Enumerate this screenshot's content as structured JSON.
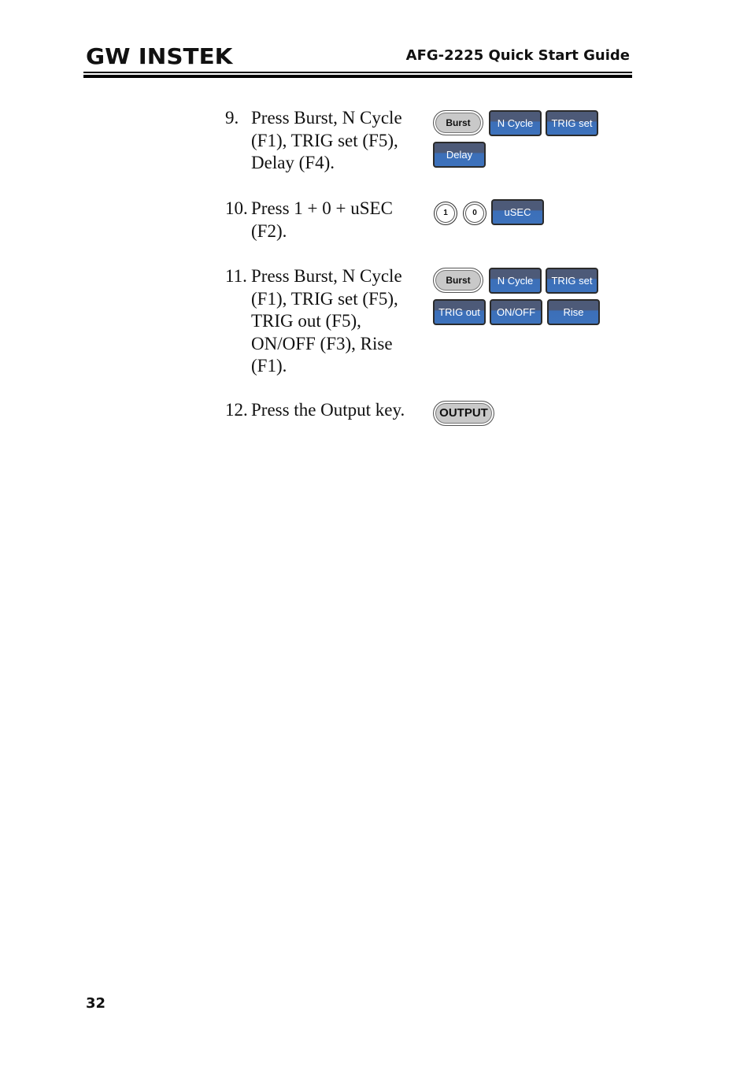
{
  "header": {
    "logo": "GW INSTEK",
    "title": "AFG-2225 Quick Start Guide"
  },
  "steps": [
    {
      "number": "9.",
      "lines": [
        "Press Burst, N Cycle",
        "(F1), TRIG set (F5),",
        "Delay (F4)."
      ],
      "keys": [
        {
          "label": "Burst",
          "type": "hard"
        },
        {
          "label": "N Cycle",
          "type": "soft"
        },
        {
          "label": "TRIG set",
          "type": "soft"
        },
        {
          "label": "Delay",
          "type": "soft"
        }
      ]
    },
    {
      "number": "10.",
      "lines": [
        "Press 1 + 0 + uSEC",
        "(F2)."
      ],
      "keys": [
        {
          "label": "1",
          "type": "number"
        },
        {
          "label": "0",
          "type": "number"
        },
        {
          "label": "uSEC",
          "type": "soft"
        }
      ]
    },
    {
      "number": "11.",
      "lines": [
        "Press Burst, N Cycle",
        "(F1), TRIG set (F5),",
        "TRIG out (F5),",
        "ON/OFF (F3), Rise",
        "(F1)."
      ],
      "keys": [
        {
          "label": "Burst",
          "type": "hard"
        },
        {
          "label": "N Cycle",
          "type": "soft"
        },
        {
          "label": "TRIG set",
          "type": "soft"
        },
        {
          "label": "TRIG out",
          "type": "soft"
        },
        {
          "label": "ON/OFF",
          "type": "soft"
        },
        {
          "label": "Rise",
          "type": "soft"
        }
      ]
    },
    {
      "number": "12.",
      "lines": [
        "Press the Output key."
      ],
      "keys": [
        {
          "label": "OUTPUT",
          "type": "hard"
        }
      ]
    }
  ],
  "footer": {
    "page_number": "32"
  },
  "colors": {
    "soft_key_top": "#4d5a78",
    "soft_key_bottom": "#3d72bc",
    "hard_key": "#c9c9c9"
  }
}
